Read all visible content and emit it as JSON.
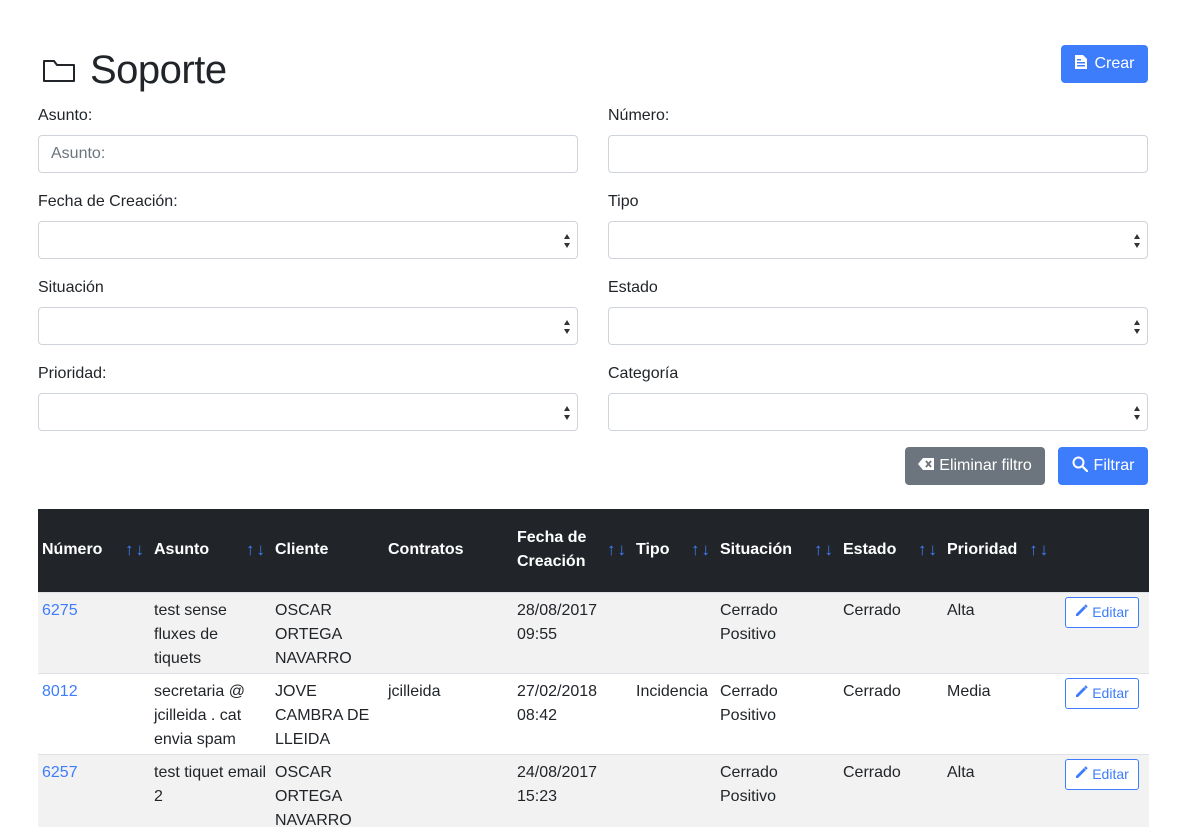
{
  "header": {
    "title": "Soporte",
    "create_label": "Crear"
  },
  "filters": {
    "asunto": {
      "label": "Asunto:",
      "placeholder": "Asunto:",
      "value": ""
    },
    "numero": {
      "label": "Número:",
      "value": ""
    },
    "fecha": {
      "label": "Fecha de Creación:",
      "value": ""
    },
    "tipo": {
      "label": "Tipo",
      "value": ""
    },
    "situacion": {
      "label": "Situación",
      "value": ""
    },
    "estado": {
      "label": "Estado",
      "value": ""
    },
    "prioridad": {
      "label": "Prioridad:",
      "value": ""
    },
    "categoria": {
      "label": "Categoría",
      "value": ""
    },
    "clear_label": "Eliminar filtro",
    "filter_label": "Filtrar"
  },
  "table": {
    "columns": [
      "Número",
      "Asunto",
      "Cliente",
      "Contratos",
      "Fecha de Creación",
      "Tipo",
      "Situación",
      "Estado",
      "Prioridad"
    ],
    "sort_glyph": "↑↓",
    "edit_label": "Editar",
    "rows": [
      {
        "numero": "6275",
        "asunto": "test sense fluxes de tiquets",
        "cliente": "OSCAR ORTEGA NAVARRO",
        "contratos": "",
        "fecha": "28/08/2017 09:55",
        "tipo": "",
        "situacion": "Cerrado Positivo",
        "estado": "Cerrado",
        "prioridad": "Alta"
      },
      {
        "numero": "8012",
        "asunto": "secretaria @ jcilleida . cat envia spam",
        "cliente": "JOVE CAMBRA DE LLEIDA",
        "contratos": "jcilleida",
        "fecha": "27/02/2018 08:42",
        "tipo": "Incidencia",
        "situacion": "Cerrado Positivo",
        "estado": "Cerrado",
        "prioridad": "Media"
      },
      {
        "numero": "6257",
        "asunto": "test tiquet email 2",
        "cliente": "OSCAR ORTEGA NAVARRO",
        "contratos": "",
        "fecha": "24/08/2017 15:23",
        "tipo": "",
        "situacion": "Cerrado Positivo",
        "estado": "Cerrado",
        "prioridad": "Alta"
      }
    ]
  },
  "colors": {
    "primary": "#3d7dfb",
    "secondary": "#6c757d",
    "table_header": "#212529"
  }
}
